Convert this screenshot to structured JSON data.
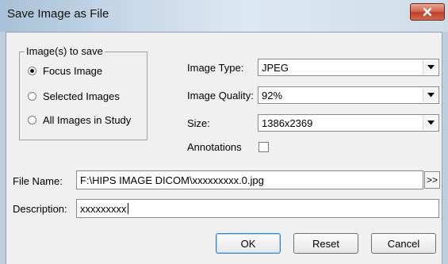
{
  "window": {
    "title": "Save Image as File",
    "close_icon": "close-x-icon"
  },
  "images_group": {
    "title": "Image(s) to save",
    "options": [
      {
        "label": "Focus Image",
        "checked": true
      },
      {
        "label": "Selected Images",
        "checked": false
      },
      {
        "label": "All Images in Study",
        "checked": false
      }
    ]
  },
  "settings": {
    "image_type_label": "Image Type:",
    "image_type_value": "JPEG",
    "image_quality_label": "Image Quality:",
    "image_quality_value": "92%",
    "size_label": "Size:",
    "size_value": "1386x2369",
    "annotations_label": "Annotations",
    "annotations_checked": false
  },
  "file": {
    "file_name_label": "File Name:",
    "file_name_value": "F:\\HIPS IMAGE DICOM\\xxxxxxxxx.0.jpg",
    "browse_label": ">>",
    "description_label": "Description:",
    "description_value": "xxxxxxxxx"
  },
  "buttons": {
    "ok": "OK",
    "reset": "Reset",
    "cancel": "Cancel"
  },
  "colors": {
    "titlebar": "#c9d9e9",
    "close": "#c0402a",
    "dialog_bg": "#f0f0f0"
  }
}
